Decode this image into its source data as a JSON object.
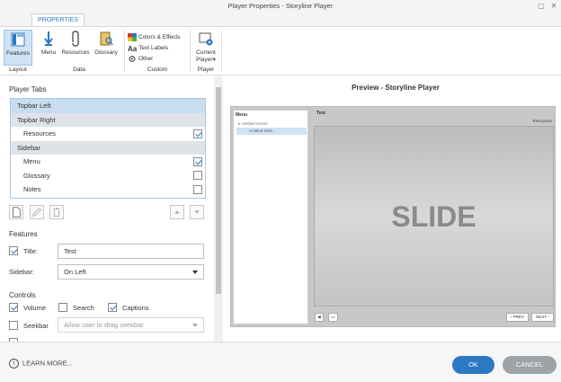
{
  "window": {
    "title": "Player Properties - Storyline Player"
  },
  "ribbon": {
    "tab": "PROPERTIES",
    "buttons": {
      "features": "Features",
      "menu": "Menu",
      "resources": "Resources",
      "glossary": "Glossary",
      "current_player": "Current Player"
    },
    "small": {
      "colors": "Colors & Effects",
      "text_labels": "Text Labels",
      "other": "Other"
    },
    "groups": {
      "layout": "Layout",
      "data": "Data",
      "custom": "Custom",
      "player": "Player"
    }
  },
  "player_tabs": {
    "heading": "Player Tabs",
    "items": [
      {
        "label": "Topbar Left",
        "kind": "group"
      },
      {
        "label": "Topbar Right",
        "kind": "group"
      },
      {
        "label": "Resources",
        "kind": "child",
        "checked": true
      },
      {
        "label": "Sidebar",
        "kind": "group"
      },
      {
        "label": "Menu",
        "kind": "child",
        "checked": true
      },
      {
        "label": "Glossary",
        "kind": "child",
        "checked": false
      },
      {
        "label": "Notes",
        "kind": "child",
        "checked": false
      }
    ]
  },
  "features": {
    "heading": "Features",
    "title_label": "Title:",
    "title_value": "Test",
    "sidebar_label": "Sidebar:",
    "sidebar_value": "On Left"
  },
  "controls": {
    "heading": "Controls",
    "volume": "Volume",
    "search": "Search",
    "captions": "Captions",
    "seekbar": "Seekbar",
    "seekbar_option": "Allow user to drag seekbar"
  },
  "preview": {
    "heading": "Preview - Storyline Player",
    "menu_tab": "Menu",
    "scene": "Untitled Scene",
    "slide_item": "Untitled Slide",
    "title": "Test",
    "resources": "Resources",
    "slide_text": "SLIDE",
    "prev": "PREV",
    "next": "NEXT"
  },
  "footer": {
    "learn_more": "LEARN MORE...",
    "ok": "OK",
    "cancel": "CANCEL"
  }
}
